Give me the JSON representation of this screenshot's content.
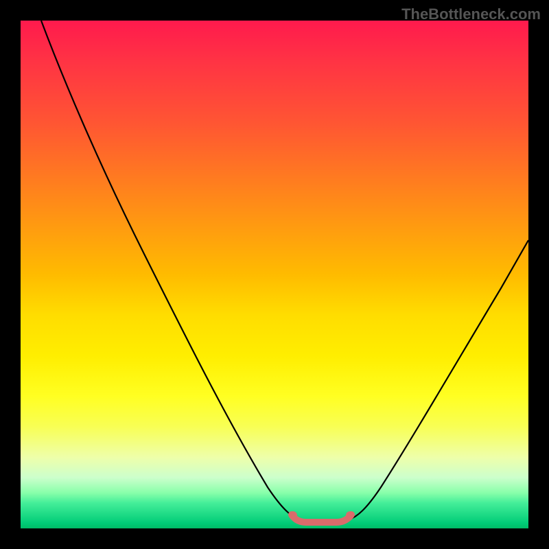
{
  "watermark": "TheBottleneck.com",
  "chart_data": {
    "type": "line",
    "title": "",
    "xlabel": "",
    "ylabel": "",
    "xlim": [
      0,
      100
    ],
    "ylim": [
      0,
      100
    ],
    "background_gradient": {
      "orientation": "vertical",
      "stops": [
        {
          "pos": 0,
          "color": "#ff1a4d"
        },
        {
          "pos": 50,
          "color": "#ffdd00"
        },
        {
          "pos": 90,
          "color": "#ccffcc"
        },
        {
          "pos": 100,
          "color": "#00bb66"
        }
      ]
    },
    "series": [
      {
        "name": "bottleneck-curve",
        "x": [
          4,
          10,
          20,
          30,
          40,
          48,
          53,
          56,
          60,
          64,
          68,
          75,
          85,
          95,
          100
        ],
        "y": [
          100,
          87,
          68,
          50,
          32,
          15,
          6,
          2,
          1,
          1,
          2,
          10,
          28,
          48,
          58
        ],
        "color": "#000000"
      }
    ],
    "annotations": [
      {
        "name": "valley-highlight",
        "type": "marker",
        "x_range": [
          53,
          68
        ],
        "y": 1,
        "color": "#d96b6b"
      }
    ]
  }
}
